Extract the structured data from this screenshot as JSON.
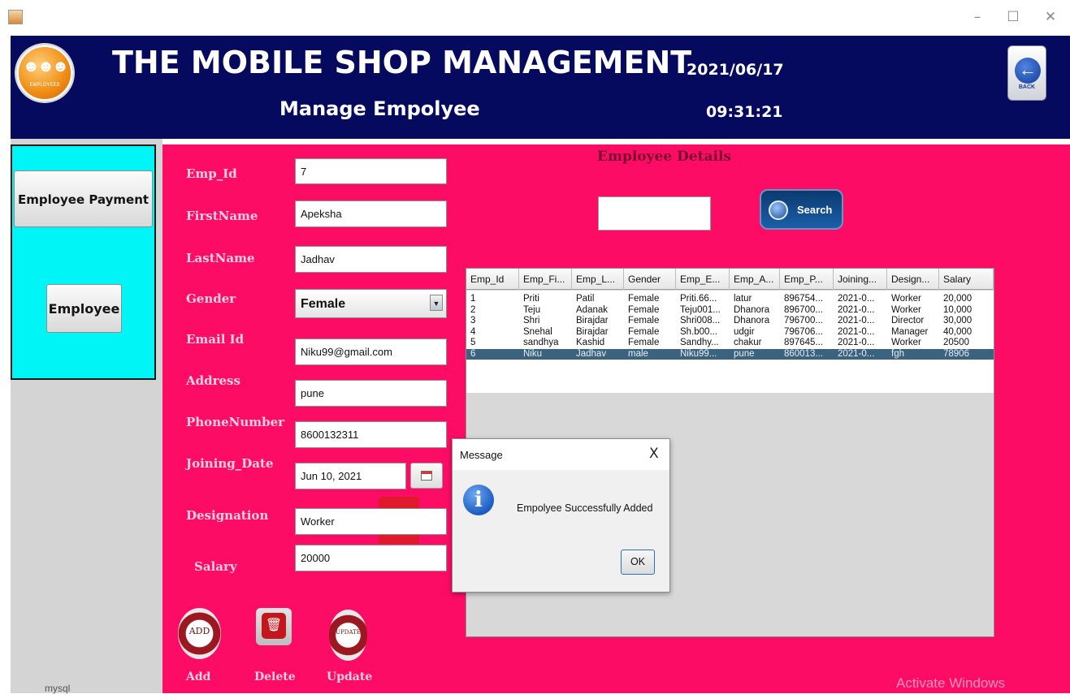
{
  "window": {
    "minimize": "–",
    "maximize": "☐",
    "close": "✕"
  },
  "header": {
    "title": "THE MOBILE SHOP MANAGEMENT",
    "subtitle": "Manage Empolyee",
    "date": "2021/06/17",
    "time": "09:31:21",
    "logo_caption": "EMPLOYEES",
    "back_caption": "BACK"
  },
  "sidebar": {
    "payment_label": "Employee Payment",
    "employee_label": "Employee"
  },
  "form": {
    "labels": {
      "emp_id": "Emp_Id",
      "firstname": "FirstName",
      "lastname": "LastName",
      "gender": "Gender",
      "email": "Email Id",
      "address": "Address",
      "phone": "PhoneNumber",
      "joining": "Joining_Date",
      "designation": "Designation",
      "salary": "Salary"
    },
    "values": {
      "emp_id": "7",
      "firstname": "Apeksha",
      "lastname": "Jadhav",
      "gender": "Female",
      "email": "Niku99@gmail.com",
      "address": "pune",
      "phone": "8600132311",
      "joining": "Jun 10, 2021",
      "designation": "Worker",
      "salary": "20000"
    }
  },
  "actions": {
    "add_icon_text": "ADD",
    "update_icon_text": "UPDATE",
    "add": "Add",
    "delete": "Delete",
    "update": "Update"
  },
  "details": {
    "title": "Employee Details",
    "search_button": "Search",
    "search_value": ""
  },
  "table": {
    "columns": [
      "Emp_Id",
      "Emp_Fi...",
      "Emp_L...",
      "Gender",
      "Emp_E...",
      "Emp_A...",
      "Emp_P...",
      "Joining...",
      "Design...",
      "Salary"
    ],
    "rows": [
      [
        "1",
        "Priti",
        "Patil",
        "Female",
        "Priti.66...",
        "latur",
        "896754...",
        "2021-0...",
        "Worker",
        "20,000"
      ],
      [
        "2",
        "Teju",
        "Adanak",
        "Female",
        "Teju001...",
        "Dhanora",
        "896700...",
        "2021-0...",
        "Worker",
        "10,000"
      ],
      [
        "3",
        "Shri",
        "Birajdar",
        "Female",
        "Shri008...",
        "Dhanora",
        "796700...",
        "2021-0...",
        "Director",
        "30,000"
      ],
      [
        "4",
        "Snehal",
        "Birajdar",
        "Female",
        "Sh.b00...",
        "udgir",
        "796706...",
        "2021-0...",
        "Manager",
        "40,000"
      ],
      [
        "5",
        "sandhya",
        "Kashid",
        "Female",
        "Sandhy...",
        "chakur",
        "897645...",
        "2021-0...",
        "Worker",
        "20500"
      ],
      [
        "6",
        "Niku",
        "Jadhav",
        "male",
        "Niku99...",
        "pune",
        "860013...",
        "2021-0...",
        "fgh",
        "78906"
      ]
    ],
    "selected_row_index": 5
  },
  "dialog": {
    "title": "Message",
    "close": "X",
    "icon": "i",
    "message": "Empolyee Successfully Added",
    "ok": "OK"
  },
  "bottom": {
    "mysql": "mysql",
    "watermark": "Activate Windows"
  },
  "colors": {
    "header": "#060a5f",
    "main": "#fd0c66",
    "side_panel": "#00f5f7",
    "selected_row": "#3b627f"
  }
}
